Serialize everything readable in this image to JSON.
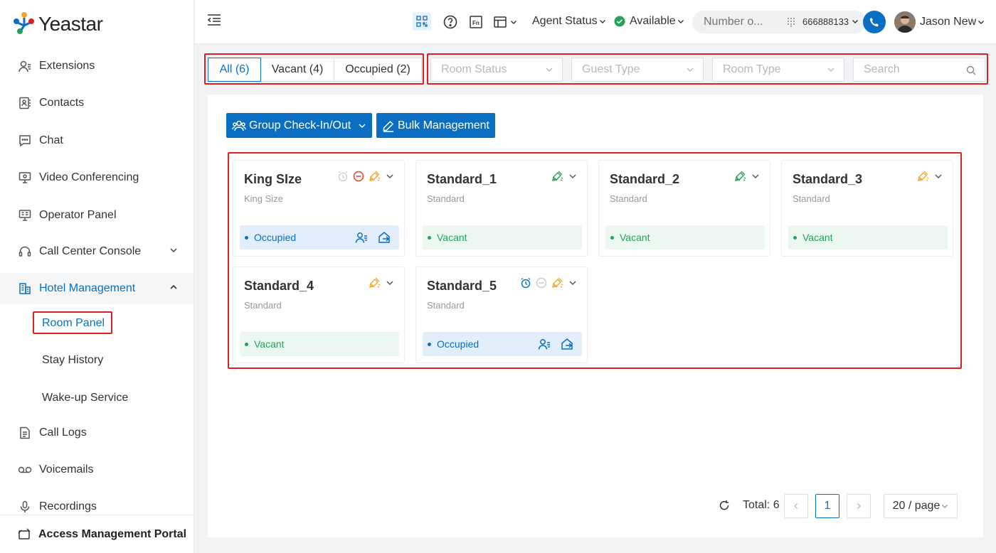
{
  "app": {
    "logo_text": "Yeastar"
  },
  "sidebar": {
    "items": [
      {
        "label": "Extensions",
        "icon": "extensions-icon"
      },
      {
        "label": "Contacts",
        "icon": "contacts-icon"
      },
      {
        "label": "Chat",
        "icon": "chat-icon"
      },
      {
        "label": "Video Conferencing",
        "icon": "video-conferencing-icon"
      },
      {
        "label": "Operator Panel",
        "icon": "operator-panel-icon"
      },
      {
        "label": "Call Center Console",
        "icon": "headset-icon"
      },
      {
        "label": "Hotel Management",
        "icon": "hotel-icon"
      },
      {
        "label": "Call Logs",
        "icon": "call-logs-icon"
      },
      {
        "label": "Voicemails",
        "icon": "voicemail-icon"
      },
      {
        "label": "Recordings",
        "icon": "microphone-icon"
      }
    ],
    "hotel_sub": [
      {
        "label": "Room Panel"
      },
      {
        "label": "Stay History"
      },
      {
        "label": "Wake-up Service"
      }
    ],
    "portal_label": "Access Management Portal"
  },
  "header": {
    "agent_status": "Agent Status",
    "availability": "Available",
    "number_placeholder": "Number o...",
    "extension": "666888133",
    "user_name": "Jason New"
  },
  "filters": {
    "tabs": [
      {
        "label": "All (6)",
        "active": true
      },
      {
        "label": "Vacant (4)",
        "active": false
      },
      {
        "label": "Occupied (2)",
        "active": false
      }
    ],
    "room_status_placeholder": "Room Status",
    "guest_type_placeholder": "Guest Type",
    "room_type_placeholder": "Room Type",
    "search_placeholder": "Search"
  },
  "toolbar": {
    "group_check": "Group Check-In/Out",
    "bulk_management": "Bulk Management"
  },
  "rooms": [
    {
      "name": "King SIze",
      "type": "King Size",
      "status": "Occupied"
    },
    {
      "name": "Standard_1",
      "type": "Standard",
      "status": "Vacant"
    },
    {
      "name": "Standard_2",
      "type": "Standard",
      "status": "Vacant"
    },
    {
      "name": "Standard_3",
      "type": "Standard",
      "status": "Vacant"
    },
    {
      "name": "Standard_4",
      "type": "Standard",
      "status": "Vacant"
    },
    {
      "name": "Standard_5",
      "type": "Standard",
      "status": "Occupied"
    }
  ],
  "pagination": {
    "total": "Total: 6",
    "current_page": "1",
    "page_size": "20 / page"
  },
  "colors": {
    "accent": "#0a6fc2",
    "vacant": "#22a35a",
    "clean_orange": "#f5a623",
    "clean_green": "#22a35a",
    "dnd_red": "#e0452e",
    "highlight_red": "#e02020"
  }
}
